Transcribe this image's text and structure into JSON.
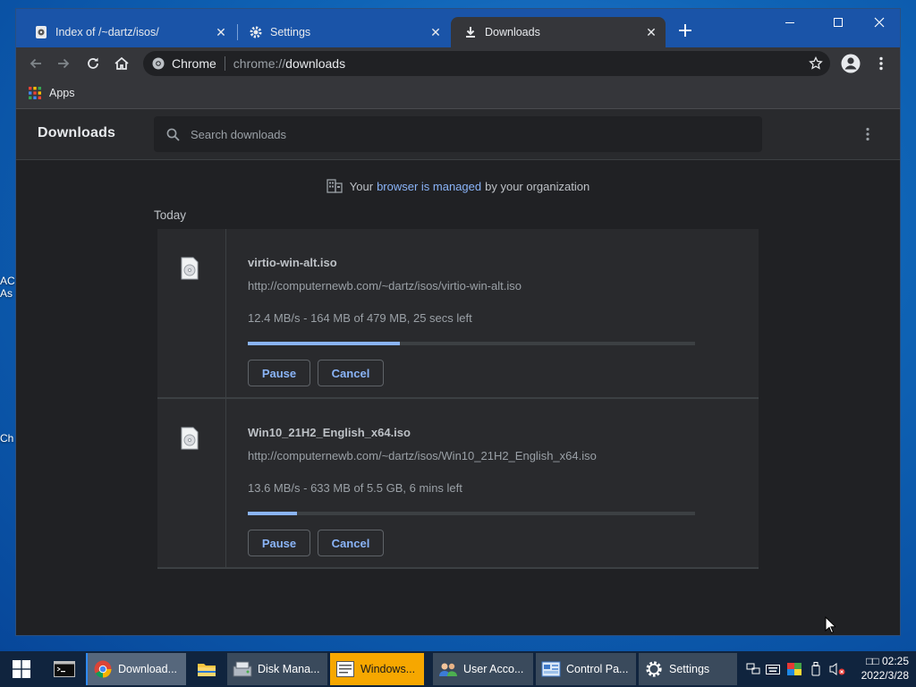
{
  "desktop": {
    "fragments": [
      "AC",
      "As",
      "Ch"
    ]
  },
  "browser": {
    "tabs": [
      {
        "title": "Index of /~dartz/isos/",
        "icon": "page-favicon-icon",
        "active": false
      },
      {
        "title": "Settings",
        "icon": "gear-icon",
        "active": false
      },
      {
        "title": "Downloads",
        "icon": "download-icon",
        "active": true
      }
    ],
    "omnibox": {
      "site_label": "Chrome",
      "scheme": "chrome://",
      "path": "downloads"
    },
    "bookmarks": {
      "apps_label": "Apps"
    }
  },
  "downloads_page": {
    "title": "Downloads",
    "search_placeholder": "Search downloads",
    "managed_notice": {
      "prefix": "Your",
      "link": "browser is managed",
      "suffix": "by your organization"
    },
    "section_label": "Today",
    "items": [
      {
        "filename": "virtio-win-alt.iso",
        "url": "http://computernewb.com/~dartz/isos/virtio-win-alt.iso",
        "status": "12.4 MB/s - 164 MB of 479 MB, 25 secs left",
        "progress": 0.34,
        "pause_label": "Pause",
        "cancel_label": "Cancel"
      },
      {
        "filename": "Win10_21H2_English_x64.iso",
        "url": "http://computernewb.com/~dartz/isos/Win10_21H2_English_x64.iso",
        "status": "13.6 MB/s - 633 MB of 5.5 GB, 6 mins left",
        "progress": 0.11,
        "pause_label": "Pause",
        "cancel_label": "Cancel"
      }
    ]
  },
  "taskbar": {
    "items": [
      {
        "label": "Download...",
        "icon": "chrome-icon"
      },
      {
        "label": "",
        "icon": "file-explorer-icon"
      },
      {
        "label": "Disk Mana...",
        "icon": "disk-management-icon"
      },
      {
        "label": "Windows...",
        "icon": "windows-setup-icon"
      },
      {
        "label": "User Acco...",
        "icon": "user-accounts-icon"
      },
      {
        "label": "Control Pa...",
        "icon": "control-panel-icon"
      },
      {
        "label": "Settings",
        "icon": "settings-gear-icon"
      }
    ],
    "clock": {
      "time": "□□ 02:25",
      "date": "2022/3/28"
    }
  },
  "colors": {
    "accent": "#8ab4f8",
    "tabstrip": "#1a54a8",
    "page_bg": "#202124",
    "card_bg": "#292a2d"
  }
}
